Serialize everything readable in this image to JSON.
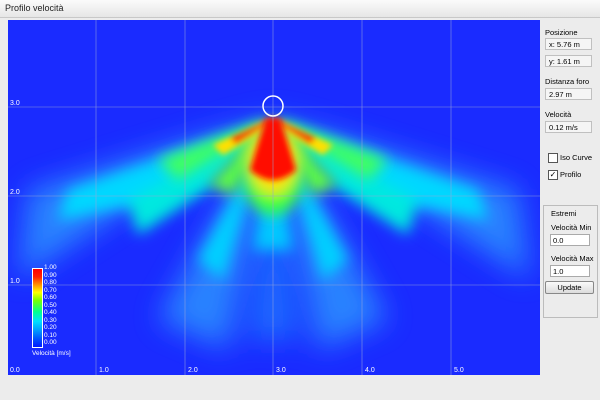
{
  "window": {
    "title": "Profilo velocità"
  },
  "plot": {
    "x_ticks": [
      "0.0",
      "1.0",
      "2.0",
      "3.0",
      "4.0",
      "5.0"
    ],
    "y_ticks": [
      "1.0",
      "2.0",
      "3.0"
    ],
    "hole_marker": "circle"
  },
  "colorbar": {
    "title": "Velocità [m/s]",
    "labels": [
      "1.00",
      "0.90",
      "0.80",
      "0.70",
      "0.60",
      "0.50",
      "0.40",
      "0.30",
      "0.20",
      "0.10",
      "0.00"
    ],
    "colors": {
      "low": "#0018ff",
      "mid": "#00ff90",
      "high": "#ff0000"
    }
  },
  "sidebar": {
    "posizione_label": "Posizione",
    "x_value": "x: 5.76 m",
    "y_value": "y: 1.61 m",
    "distanza_label": "Distanza foro",
    "distanza_value": "2.97 m",
    "velocita_label": "Velocità",
    "velocita_value": "0.12 m/s",
    "iso_curve": {
      "label": "Iso Curve",
      "checked": false
    },
    "profilo": {
      "label": "Profilo",
      "checked": true
    },
    "estremi": {
      "title": "Estremi",
      "min_label": "Velocità Min",
      "min_value": "0.0",
      "max_label": "Velocità Max",
      "max_value": "1.0"
    },
    "update_label": "Update"
  }
}
